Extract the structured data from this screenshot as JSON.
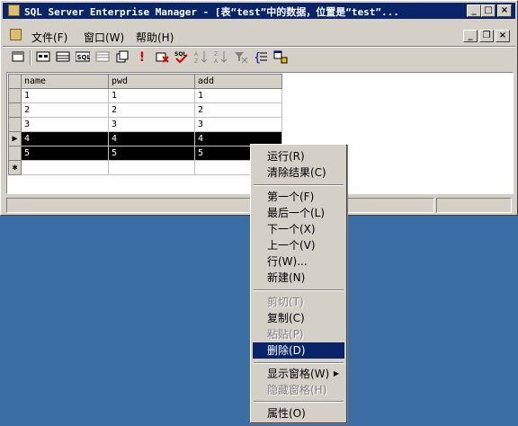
{
  "window": {
    "title": "SQL Server Enterprise Manager - [表“test”中的数据，位置是“test”...",
    "controls": {
      "minimize": "_",
      "maximize": "□",
      "close": "×"
    }
  },
  "menubar": {
    "items": [
      {
        "label": "文件(F)"
      },
      {
        "label": "窗口(W)"
      },
      {
        "label": "帮助(H)"
      }
    ],
    "doc_controls": {
      "minimize": "_",
      "restore": "❐",
      "close": "×"
    }
  },
  "toolbar": {
    "icons": [
      "properties-icon",
      "show-diagram-pane-icon",
      "show-grid-pane-icon",
      "show-sql-pane-icon",
      "show-results-pane-icon",
      "change-query-type-icon",
      "run-icon",
      "cancel-query-icon",
      "verify-sql-icon",
      "sort-ascending-icon",
      "sort-descending-icon",
      "remove-filter-icon",
      "use-group-by-icon",
      "add-table-icon"
    ]
  },
  "grid": {
    "columns": [
      "name",
      "pwd",
      "add"
    ],
    "rows": [
      [
        "1",
        "1",
        "1"
      ],
      [
        "2",
        "2",
        "2"
      ],
      [
        "3",
        "3",
        "3"
      ],
      [
        "4",
        "4",
        "4"
      ],
      [
        "5",
        "5",
        "5"
      ]
    ],
    "current_row_marker": "▶",
    "new_row_marker": "✱"
  },
  "context_menu": {
    "items": [
      {
        "label": "运行(R)",
        "enabled": true
      },
      {
        "label": "清除结果(C)",
        "enabled": true
      },
      {
        "label": "第一个(F)",
        "enabled": true
      },
      {
        "label": "最后一个(L)",
        "enabled": true
      },
      {
        "label": "下一个(X)",
        "enabled": true
      },
      {
        "label": "上一个(V)",
        "enabled": true
      },
      {
        "label": "行(W)...",
        "enabled": true
      },
      {
        "label": "新建(N)",
        "enabled": true
      },
      {
        "label": "剪切(T)",
        "enabled": false
      },
      {
        "label": "复制(C)",
        "enabled": true
      },
      {
        "label": "粘贴(P)",
        "enabled": false
      },
      {
        "label": "删除(D)",
        "enabled": true,
        "highlighted": true
      },
      {
        "label": "显示窗格(W)",
        "enabled": true
      },
      {
        "label": "隐藏窗格(H)",
        "enabled": false
      },
      {
        "label": "属性(O)",
        "enabled": true
      }
    ]
  },
  "colors": {
    "desktop": "#3a6ea5",
    "titlebar": "#0a246a",
    "selection": "#0a246a",
    "face": "#d4d0c8"
  }
}
